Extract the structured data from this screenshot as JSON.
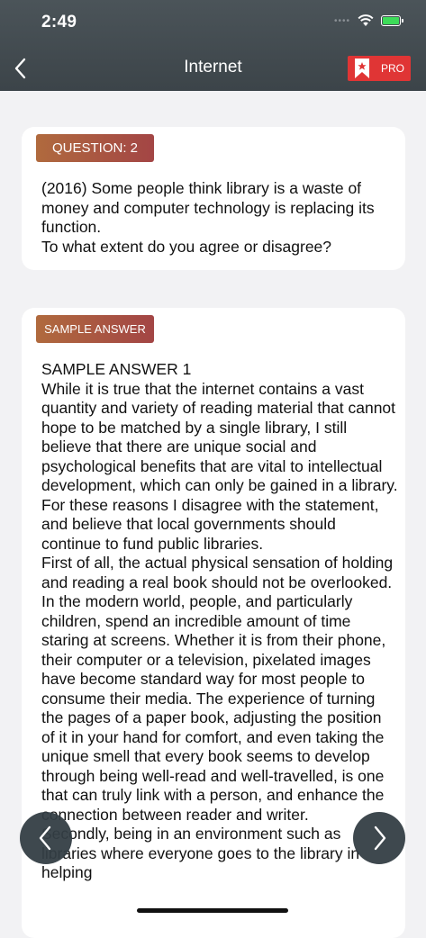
{
  "status_bar": {
    "time": "2:49"
  },
  "header": {
    "title": "Internet",
    "pro_label": "PRO"
  },
  "question": {
    "tag": "QUESTION: 2",
    "text": "(2016) Some people think library is a waste of money and computer technology is replacing its function.\nTo what extent do you agree or disagree?"
  },
  "answer": {
    "tag": "SAMPLE ANSWER",
    "text": "SAMPLE ANSWER 1\nWhile it is true that the internet contains a vast quantity and variety of reading material that cannot hope to be matched by a single library, I still believe that there are unique social and psychological benefits that are vital to intellectual development, which can only be gained in a library. For these reasons I disagree with the statement, and believe that local governments should continue to fund public libraries.\nFirst of all, the actual physical sensation of holding and reading a real book should not be overlooked. In the modern world, people, and particularly children, spend an incredible amount of time staring at screens. Whether it is from their phone, their computer or a television, pixelated images have become standard way for most people to consume their media. The experience of turning the pages of a paper book, adjusting the position of it in your hand for comfort, and even taking the unique smell that every book seems to develop through being well-read and well-travelled, is one that can truly link with a person, and enhance the connection between reader and writer.\nSecondly, being in an environment such as libraries where everyone goes to the library in helping"
  },
  "colors": {
    "header": "#434b50",
    "tag_start": "#b06a3e",
    "tag_end": "#a34545",
    "pro": "#e03535",
    "battery": "#3ddc59"
  }
}
